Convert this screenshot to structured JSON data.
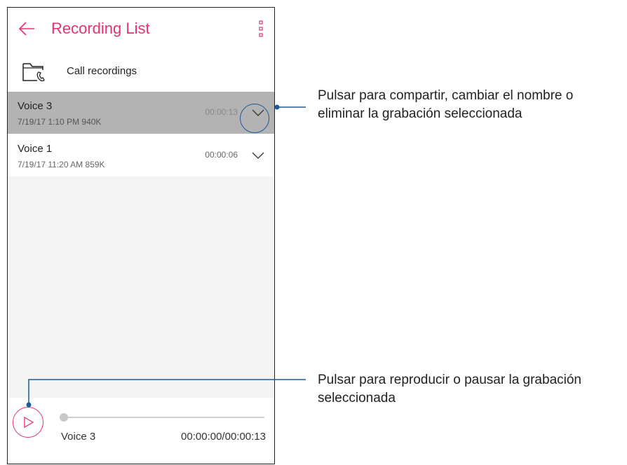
{
  "app_bar": {
    "title": "Recording List",
    "back_icon": "arrow-left-icon",
    "menu_icon": "more-vert-icon"
  },
  "call_recordings": {
    "label": "Call recordings",
    "icon": "folder-phone-icon"
  },
  "recordings": [
    {
      "name": "Voice 3",
      "meta": "7/19/17 1:10 PM   940K",
      "duration": "00:00:13",
      "selected": true
    },
    {
      "name": "Voice 1",
      "meta": "7/19/17 11:20 AM   859K",
      "duration": "00:00:06",
      "selected": false
    }
  ],
  "player": {
    "track_name": "Voice 3",
    "time": "00:00:00/00:00:13",
    "progress": 0
  },
  "callouts": {
    "top": [
      "Pulsar para compartir, cambiar el nombre o",
      "eliminar la grabación seleccionada"
    ],
    "bottom": [
      "Pulsar para reproducir o pausar la grabación",
      "seleccionada"
    ]
  },
  "colors": {
    "accent": "#e6336b",
    "callout_line": "#1e5a96",
    "selected_row": "#b3b3b3",
    "empty_area": "#f3f3f3"
  }
}
